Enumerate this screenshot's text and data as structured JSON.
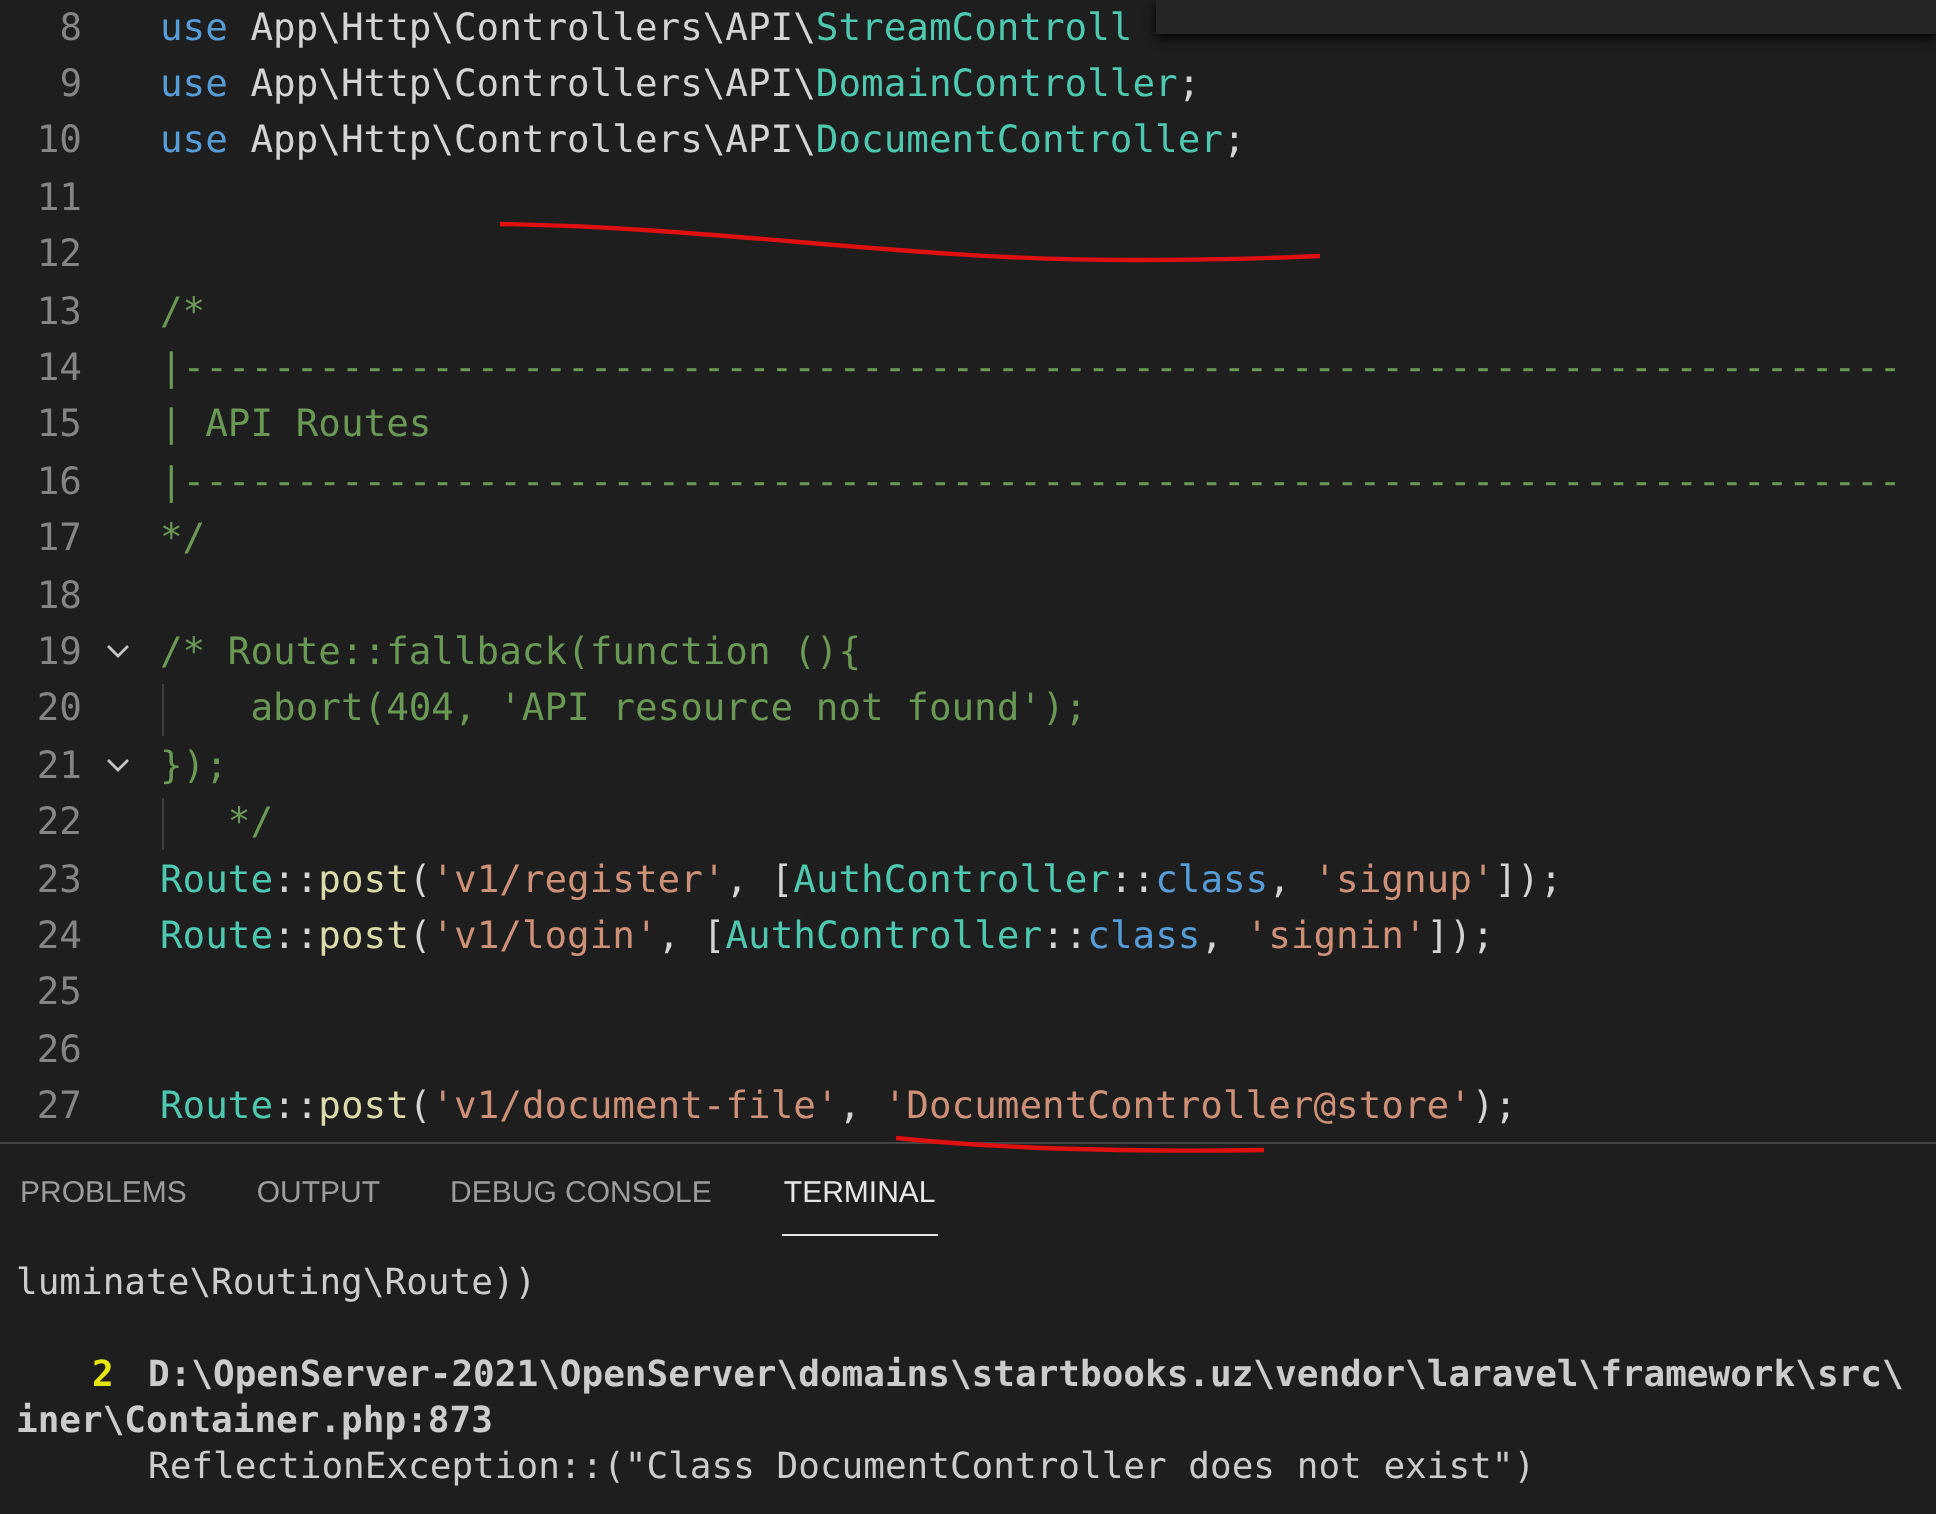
{
  "editor": {
    "lines": [
      {
        "number": "8",
        "tokens": [
          {
            "kind": "keyword",
            "text": "use"
          },
          {
            "kind": "plain",
            "text": " App\\Http\\Controllers\\API\\"
          },
          {
            "kind": "class",
            "text": "StreamControll"
          }
        ]
      },
      {
        "number": "9",
        "tokens": [
          {
            "kind": "keyword",
            "text": "use"
          },
          {
            "kind": "plain",
            "text": " App\\Http\\Controllers\\API\\"
          },
          {
            "kind": "class",
            "text": "DomainController"
          },
          {
            "kind": "plain",
            "text": ";"
          }
        ]
      },
      {
        "number": "10",
        "tokens": [
          {
            "kind": "keyword",
            "text": "use"
          },
          {
            "kind": "plain",
            "text": " App\\Http\\Controllers\\API\\"
          },
          {
            "kind": "class",
            "text": "DocumentController"
          },
          {
            "kind": "plain",
            "text": ";"
          }
        ]
      },
      {
        "number": "11"
      },
      {
        "number": "12"
      },
      {
        "number": "13",
        "tokens": [
          {
            "kind": "comment",
            "text": "/*"
          }
        ]
      },
      {
        "number": "14",
        "tokens": [
          {
            "kind": "comment",
            "text": "|----------------------------------------------------------------------------"
          }
        ]
      },
      {
        "number": "15",
        "tokens": [
          {
            "kind": "comment",
            "text": "| API Routes"
          }
        ]
      },
      {
        "number": "16",
        "tokens": [
          {
            "kind": "comment",
            "text": "|----------------------------------------------------------------------------"
          }
        ]
      },
      {
        "number": "17",
        "tokens": [
          {
            "kind": "comment",
            "text": "*/"
          }
        ]
      },
      {
        "number": "18"
      },
      {
        "number": "19",
        "expanded": true,
        "tokens": [
          {
            "kind": "comment",
            "text": "/* Route::fallback(function (){"
          }
        ]
      },
      {
        "number": "20",
        "tokens": [
          {
            "kind": "comment",
            "text": "    abort(404, 'API resource not found');"
          }
        ]
      },
      {
        "number": "21",
        "expanded": true,
        "tokens": [
          {
            "kind": "comment",
            "text": "});"
          }
        ]
      },
      {
        "number": "22",
        "tokens": [
          {
            "kind": "comment",
            "text": "   */"
          }
        ]
      },
      {
        "number": "23",
        "tokens": [
          {
            "kind": "class",
            "text": "Route"
          },
          {
            "kind": "plain",
            "text": "::"
          },
          {
            "kind": "function",
            "text": "post"
          },
          {
            "kind": "plain",
            "text": "("
          },
          {
            "kind": "string",
            "text": "'v1/register'"
          },
          {
            "kind": "plain",
            "text": ", ["
          },
          {
            "kind": "class",
            "text": "AuthController"
          },
          {
            "kind": "plain",
            "text": "::"
          },
          {
            "kind": "keyword",
            "text": "class"
          },
          {
            "kind": "plain",
            "text": ", "
          },
          {
            "kind": "string",
            "text": "'signup'"
          },
          {
            "kind": "plain",
            "text": "]);"
          }
        ]
      },
      {
        "number": "24",
        "tokens": [
          {
            "kind": "class",
            "text": "Route"
          },
          {
            "kind": "plain",
            "text": "::"
          },
          {
            "kind": "function",
            "text": "post"
          },
          {
            "kind": "plain",
            "text": "("
          },
          {
            "kind": "string",
            "text": "'v1/login'"
          },
          {
            "kind": "plain",
            "text": ", ["
          },
          {
            "kind": "class",
            "text": "AuthController"
          },
          {
            "kind": "plain",
            "text": "::"
          },
          {
            "kind": "keyword",
            "text": "class"
          },
          {
            "kind": "plain",
            "text": ", "
          },
          {
            "kind": "string",
            "text": "'signin'"
          },
          {
            "kind": "plain",
            "text": "]);"
          }
        ]
      },
      {
        "number": "25"
      },
      {
        "number": "26"
      },
      {
        "number": "27",
        "tokens": [
          {
            "kind": "class",
            "text": "Route"
          },
          {
            "kind": "plain",
            "text": "::"
          },
          {
            "kind": "function",
            "text": "post"
          },
          {
            "kind": "plain",
            "text": "("
          },
          {
            "kind": "string",
            "text": "'v1/document-file'"
          },
          {
            "kind": "plain",
            "text": ", "
          },
          {
            "kind": "string",
            "text": "'DocumentController@store'"
          },
          {
            "kind": "plain",
            "text": ");"
          }
        ]
      }
    ]
  },
  "panel": {
    "tabs": [
      {
        "label": "PROBLEMS",
        "selected": false
      },
      {
        "label": "OUTPUT",
        "selected": false
      },
      {
        "label": "DEBUG CONSOLE",
        "selected": false
      },
      {
        "label": "TERMINAL",
        "selected": true
      }
    ],
    "terminal_lines": [
      {
        "kind": "plain",
        "text": "luminate\\Routing\\Route))"
      },
      {
        "kind": "blank"
      },
      {
        "kind": "frame",
        "index": "2",
        "text": "D:\\OpenServer-2021\\OpenServer\\domains\\startbooks.uz\\vendor\\laravel\\framework\\src\\"
      },
      {
        "kind": "bold",
        "text": "iner\\Container.php:873"
      },
      {
        "kind": "indented",
        "text": "ReflectionException::(\"Class DocumentController does not exist\")"
      }
    ]
  }
}
